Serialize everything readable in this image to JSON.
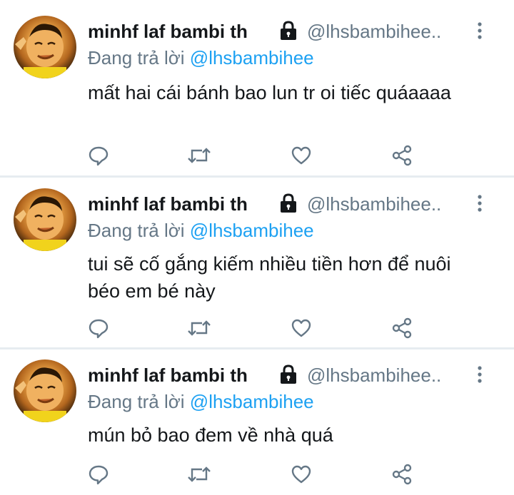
{
  "colors": {
    "name": "#14171a",
    "handle": "#657786",
    "mention": "#1da1f2",
    "icon": "#657786",
    "divider": "#e6ecf0"
  },
  "tweets": [
    {
      "display_name": "minhf laf bambi th",
      "handle": "@lhsbambihee..",
      "reply_prefix": "Đang trả lời",
      "reply_to": "@lhsbambihee",
      "text": "mất hai cái bánh bao lun tr oi tiếc quáaaaa"
    },
    {
      "display_name": "minhf laf bambi th",
      "handle": "@lhsbambihee..",
      "reply_prefix": "Đang trả lời",
      "reply_to": "@lhsbambihee",
      "text": "tui sẽ cố gắng kiếm nhiều tiền hơn để nuôi béo em bé này"
    },
    {
      "display_name": "minhf laf bambi th",
      "handle": "@lhsbambihee..",
      "reply_prefix": "Đang trả lời",
      "reply_to": "@lhsbambihee",
      "text": "mún bỏ bao đem về nhà quá"
    }
  ],
  "icons": {
    "avatar": "avatar-photo",
    "lock": "lock-icon",
    "more": "more-vertical-icon",
    "reply": "reply-icon",
    "retweet": "retweet-icon",
    "like": "like-icon",
    "share": "share-icon"
  }
}
